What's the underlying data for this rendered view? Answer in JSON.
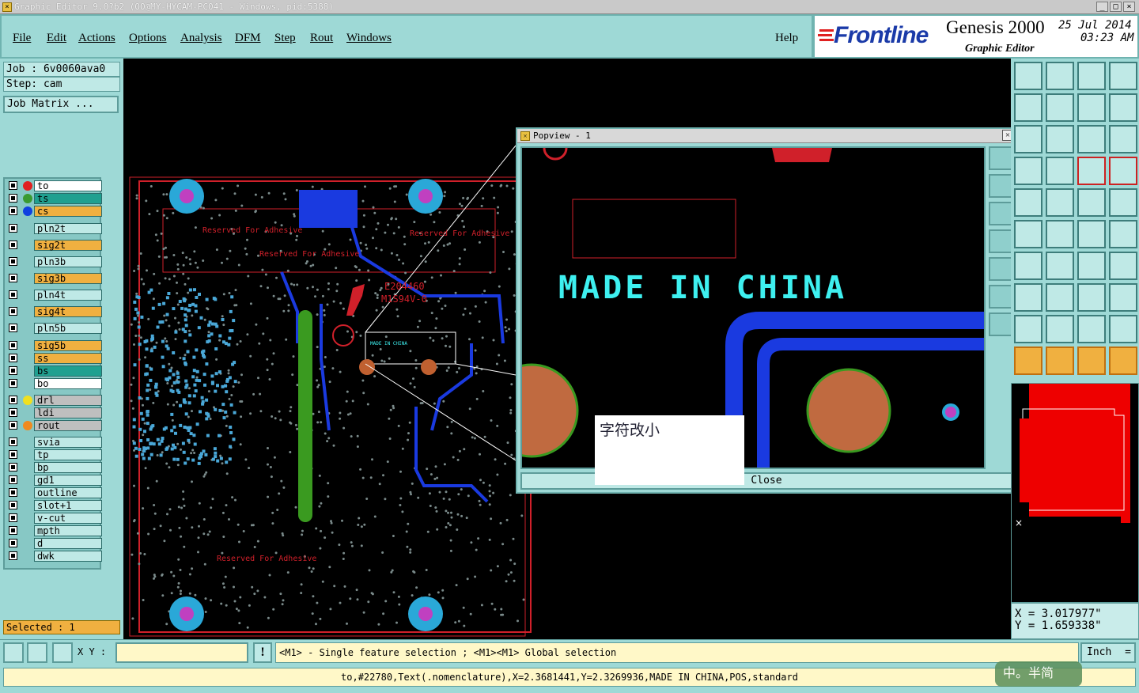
{
  "window": {
    "title": "Graphic Editor 9.0?b2 (OO@MY-HYCAM-PC041 - Windows, pid:5388)"
  },
  "menubar": {
    "items": [
      "File",
      "Edit",
      "Actions",
      "Options",
      "Analysis",
      "DFM",
      "Step",
      "Rout",
      "Windows"
    ],
    "help": "Help"
  },
  "brand": {
    "logo": "Frontline",
    "product": "Genesis 2000",
    "subtitle": "Graphic Editor",
    "date": "25 Jul 2014",
    "time": "03:23 AM"
  },
  "job": {
    "job_label": "Job : 6v0060ava0",
    "step_label": "Step: cam",
    "matrix_button": "Job Matrix ..."
  },
  "layers": [
    {
      "name": "to",
      "dot": "#e02020",
      "bg": "#ffffff"
    },
    {
      "name": "ts",
      "dot": "#3a9a30",
      "bg": "#20a090"
    },
    {
      "name": "cs",
      "dot": "#1040e0",
      "bg": "#f0b040"
    },
    {
      "name": "pln2t",
      "dot": "",
      "bg": "#bfe9e6"
    },
    {
      "name": "sig2t",
      "dot": "",
      "bg": "#f0b040"
    },
    {
      "name": "pln3b",
      "dot": "",
      "bg": "#bfe9e6"
    },
    {
      "name": "sig3b",
      "dot": "",
      "bg": "#f0b040"
    },
    {
      "name": "pln4t",
      "dot": "",
      "bg": "#bfe9e6"
    },
    {
      "name": "sig4t",
      "dot": "",
      "bg": "#f0b040"
    },
    {
      "name": "pln5b",
      "dot": "",
      "bg": "#bfe9e6"
    },
    {
      "name": "sig5b",
      "dot": "",
      "bg": "#f0b040"
    },
    {
      "name": "ss",
      "dot": "",
      "bg": "#f0b040"
    },
    {
      "name": "bs",
      "dot": "",
      "bg": "#20a090"
    },
    {
      "name": "bo",
      "dot": "",
      "bg": "#ffffff"
    },
    {
      "name": "drl",
      "dot": "#f0e020",
      "bg": "#bfbfbf"
    },
    {
      "name": "ldi",
      "dot": "",
      "bg": "#bfbfbf"
    },
    {
      "name": "rout",
      "dot": "#f08a20",
      "bg": "#bfbfbf"
    },
    {
      "name": "svia",
      "dot": "",
      "bg": "#bfe9e6"
    },
    {
      "name": "tp",
      "dot": "",
      "bg": "#bfe9e6"
    },
    {
      "name": "bp",
      "dot": "",
      "bg": "#bfe9e6"
    },
    {
      "name": "gd1",
      "dot": "",
      "bg": "#bfe9e6"
    },
    {
      "name": "outline",
      "dot": "",
      "bg": "#bfe9e6"
    },
    {
      "name": "slot+1",
      "dot": "",
      "bg": "#bfe9e6"
    },
    {
      "name": "v-cut",
      "dot": "",
      "bg": "#bfe9e6"
    },
    {
      "name": "mpth",
      "dot": "",
      "bg": "#bfe9e6"
    },
    {
      "name": "d",
      "dot": "",
      "bg": "#bfe9e6"
    },
    {
      "name": "dwk",
      "dot": "",
      "bg": "#bfe9e6"
    }
  ],
  "selected_label": "Selected : 1",
  "popview": {
    "title": "Popview - 1",
    "main_text": "MADE IN CHINA",
    "close_label": "Close"
  },
  "board_text": {
    "reserved_left": "Reserved For Adhesive",
    "reserved_center": "Reserved For Adhesive",
    "reserved_right": "Reserved For Adhesive",
    "reserved_bottom": "Reserved For Adhesive",
    "ul_code1": "E204460",
    "ul_code2": "M1S94V-0",
    "small_made": "MADE IN CHINA"
  },
  "note": "字符改小",
  "coords": {
    "x": "X = 3.017977\"",
    "y": "Y = 1.659338\""
  },
  "statusbar": {
    "xy_label": "X Y :",
    "xy_value": "",
    "hint": "<M1> - Single feature selection ; <M1><M1> Global selection",
    "units": "Inch"
  },
  "bottom_message": "to,#22780,Text(.nomenclature),X=2.3681441,Y=2.3269936,MADE IN CHINA,POS,standard",
  "ime": "中。半简"
}
